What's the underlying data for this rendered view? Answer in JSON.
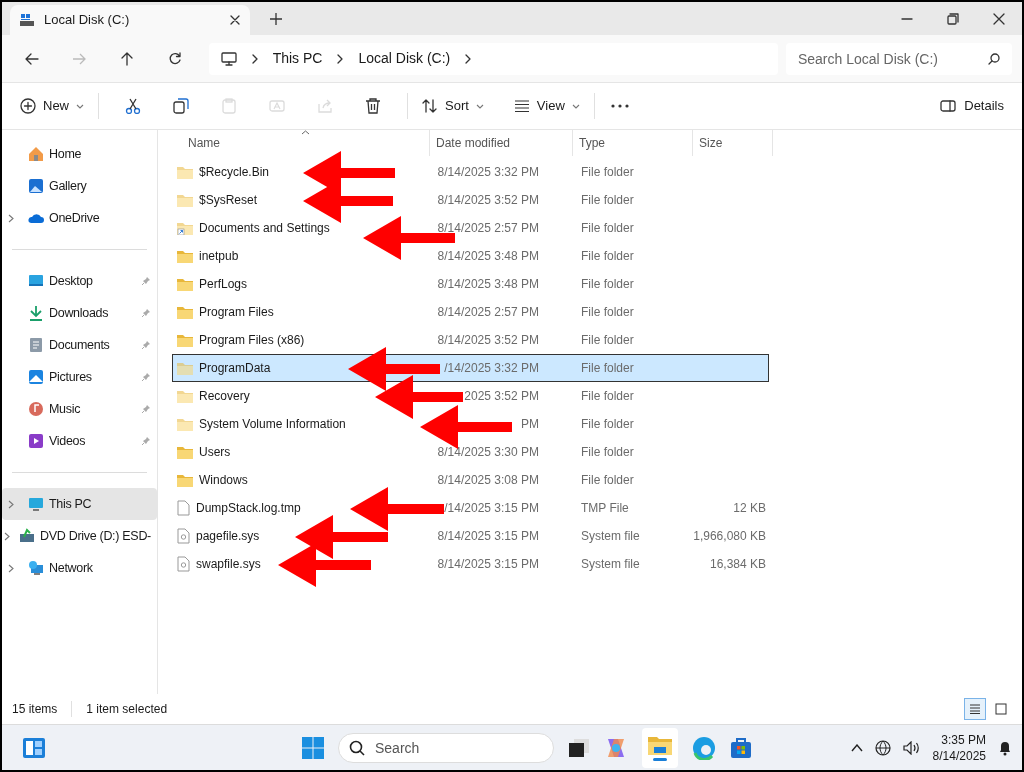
{
  "window": {
    "tab_title": "Local Disk (C:)"
  },
  "address": {
    "segments": [
      "This PC",
      "Local Disk (C:)"
    ],
    "search_placeholder": "Search Local Disk (C:)"
  },
  "toolbar": {
    "new_label": "New",
    "sort_label": "Sort",
    "view_label": "View",
    "details_label": "Details",
    "icons": [
      {
        "kind": "cut",
        "disabled": false
      },
      {
        "kind": "copy",
        "disabled": false
      },
      {
        "kind": "paste",
        "disabled": true
      },
      {
        "kind": "rename",
        "disabled": true
      },
      {
        "kind": "share",
        "disabled": true
      },
      {
        "kind": "delete",
        "disabled": false
      }
    ]
  },
  "sidebar": {
    "groups": [
      [
        {
          "label": "Home",
          "kind": "home",
          "expandable": false,
          "pinned": false,
          "selected": false
        },
        {
          "label": "Gallery",
          "kind": "gallery",
          "expandable": false,
          "pinned": false,
          "selected": false
        },
        {
          "label": "OneDrive",
          "kind": "cloud",
          "expandable": true,
          "pinned": false,
          "selected": false
        }
      ],
      [
        {
          "label": "Desktop",
          "kind": "desktop",
          "expandable": false,
          "pinned": true,
          "selected": false
        },
        {
          "label": "Downloads",
          "kind": "downloads",
          "expandable": false,
          "pinned": true,
          "selected": false
        },
        {
          "label": "Documents",
          "kind": "documents",
          "expandable": false,
          "pinned": true,
          "selected": false
        },
        {
          "label": "Pictures",
          "kind": "pictures",
          "expandable": false,
          "pinned": true,
          "selected": false
        },
        {
          "label": "Music",
          "kind": "music",
          "expandable": false,
          "pinned": true,
          "selected": false
        },
        {
          "label": "Videos",
          "kind": "videos",
          "expandable": false,
          "pinned": true,
          "selected": false
        }
      ],
      [
        {
          "label": "This PC",
          "kind": "pc",
          "expandable": true,
          "pinned": false,
          "selected": true
        },
        {
          "label": "DVD Drive (D:) ESD-",
          "kind": "dvd",
          "expandable": true,
          "pinned": false,
          "selected": false
        },
        {
          "label": "Network",
          "kind": "network",
          "expandable": true,
          "pinned": false,
          "selected": false
        }
      ]
    ]
  },
  "table": {
    "columns": [
      "Name",
      "Date modified",
      "Type",
      "Size"
    ],
    "rows": [
      {
        "name": "$Recycle.Bin",
        "date": "8/14/2025 3:32 PM",
        "type": "File folder",
        "kind": "folder",
        "hidden": true,
        "selected": false
      },
      {
        "name": "$SysReset",
        "date": "8/14/2025 3:52 PM",
        "type": "File folder",
        "kind": "folder",
        "hidden": true,
        "selected": false
      },
      {
        "name": "Documents and Settings",
        "date": "8/14/2025 2:57 PM",
        "type": "File folder",
        "kind": "shortcut",
        "hidden": true,
        "selected": false
      },
      {
        "name": "inetpub",
        "date": "8/14/2025 3:48 PM",
        "type": "File folder",
        "kind": "folder",
        "hidden": false,
        "selected": false
      },
      {
        "name": "PerfLogs",
        "date": "8/14/2025 3:48 PM",
        "type": "File folder",
        "kind": "folder",
        "hidden": false,
        "selected": false
      },
      {
        "name": "Program Files",
        "date": "8/14/2025 2:57 PM",
        "type": "File folder",
        "kind": "folder",
        "hidden": false,
        "selected": false
      },
      {
        "name": "Program Files (x86)",
        "date": "8/14/2025 3:52 PM",
        "type": "File folder",
        "kind": "folder",
        "hidden": false,
        "selected": false
      },
      {
        "name": "ProgramData",
        "date": "/14/2025 3:32 PM",
        "type": "File folder",
        "kind": "folder",
        "hidden": true,
        "selected": true
      },
      {
        "name": "Recovery",
        "date": "2025 3:52 PM",
        "type": "File folder",
        "kind": "folder",
        "hidden": true,
        "selected": false
      },
      {
        "name": "System Volume Information",
        "date": "PM",
        "type": "File folder",
        "kind": "folder",
        "hidden": true,
        "selected": false
      },
      {
        "name": "Users",
        "date": "8/14/2025 3:30 PM",
        "type": "File folder",
        "kind": "folder",
        "hidden": false,
        "selected": false
      },
      {
        "name": "Windows",
        "date": "8/14/2025 3:08 PM",
        "type": "File folder",
        "kind": "folder",
        "hidden": false,
        "selected": false
      },
      {
        "name": "DumpStack.log.tmp",
        "date": "/14/2025 3:15 PM",
        "type": "TMP File",
        "size": "12 KB",
        "kind": "file",
        "selected": false
      },
      {
        "name": "pagefile.sys",
        "date": "8/14/2025 3:15 PM",
        "type": "System file",
        "size": "1,966,080 KB",
        "kind": "system",
        "selected": false
      },
      {
        "name": "swapfile.sys",
        "date": "8/14/2025 3:15 PM",
        "type": "System file",
        "size": "16,384 KB",
        "kind": "system",
        "selected": false
      }
    ]
  },
  "status_bar": {
    "count": "15 items",
    "selection": "1 item selected"
  },
  "taskbar": {
    "search_placeholder": "Search",
    "time": "3:35 PM",
    "date": "8/14/2025"
  }
}
